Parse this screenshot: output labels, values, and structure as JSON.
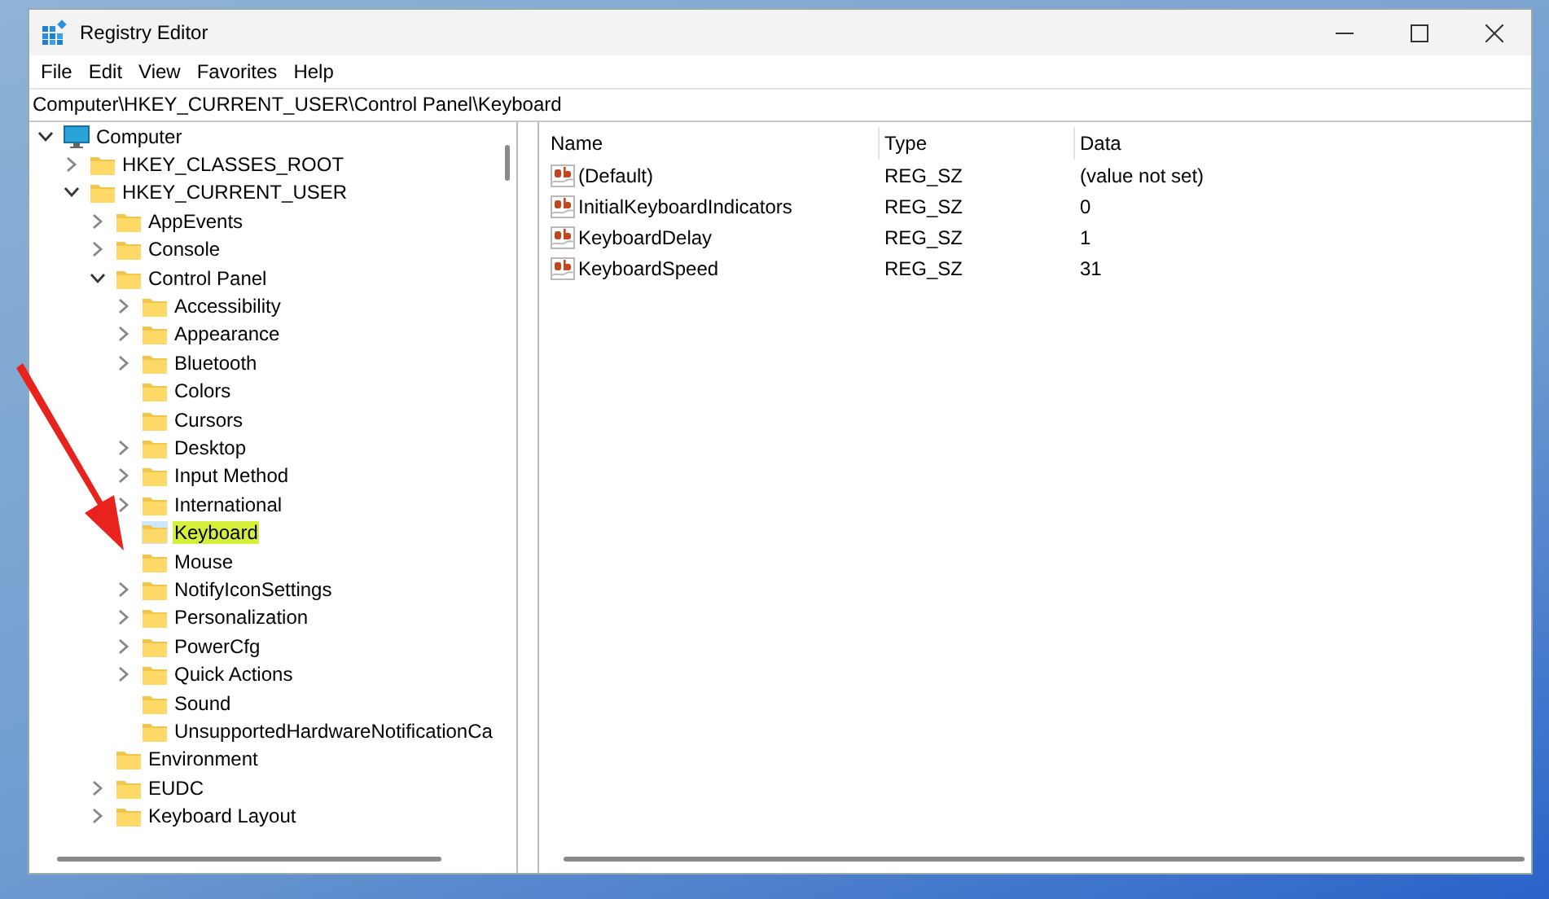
{
  "window": {
    "title": "Registry Editor"
  },
  "menu": [
    "File",
    "Edit",
    "View",
    "Favorites",
    "Help"
  ],
  "address": "Computer\\HKEY_CURRENT_USER\\Control Panel\\Keyboard",
  "tree": [
    {
      "label": "Computer",
      "kind": "computer",
      "expandable": true,
      "expanded": true,
      "selected": false,
      "children": [
        {
          "label": "HKEY_CLASSES_ROOT",
          "kind": "folder",
          "expandable": true,
          "expanded": false,
          "selected": false
        },
        {
          "label": "HKEY_CURRENT_USER",
          "kind": "folder",
          "expandable": true,
          "expanded": true,
          "selected": false,
          "children": [
            {
              "label": "AppEvents",
              "kind": "folder",
              "expandable": true,
              "expanded": false,
              "selected": false
            },
            {
              "label": "Console",
              "kind": "folder",
              "expandable": true,
              "expanded": false,
              "selected": false
            },
            {
              "label": "Control Panel",
              "kind": "folder",
              "expandable": true,
              "expanded": true,
              "selected": false,
              "children": [
                {
                  "label": "Accessibility",
                  "kind": "folder",
                  "expandable": true,
                  "expanded": false,
                  "selected": false
                },
                {
                  "label": "Appearance",
                  "kind": "folder",
                  "expandable": true,
                  "expanded": false,
                  "selected": false
                },
                {
                  "label": "Bluetooth",
                  "kind": "folder",
                  "expandable": true,
                  "expanded": false,
                  "selected": false
                },
                {
                  "label": "Colors",
                  "kind": "folder",
                  "expandable": false,
                  "selected": false
                },
                {
                  "label": "Cursors",
                  "kind": "folder",
                  "expandable": false,
                  "selected": false
                },
                {
                  "label": "Desktop",
                  "kind": "folder",
                  "expandable": true,
                  "expanded": false,
                  "selected": false
                },
                {
                  "label": "Input Method",
                  "kind": "folder",
                  "expandable": true,
                  "expanded": false,
                  "selected": false
                },
                {
                  "label": "International",
                  "kind": "folder",
                  "expandable": true,
                  "expanded": false,
                  "selected": false
                },
                {
                  "label": "Keyboard",
                  "kind": "folder",
                  "expandable": false,
                  "selected": true
                },
                {
                  "label": "Mouse",
                  "kind": "folder",
                  "expandable": false,
                  "selected": false
                },
                {
                  "label": "NotifyIconSettings",
                  "kind": "folder",
                  "expandable": true,
                  "expanded": false,
                  "selected": false
                },
                {
                  "label": "Personalization",
                  "kind": "folder",
                  "expandable": true,
                  "expanded": false,
                  "selected": false
                },
                {
                  "label": "PowerCfg",
                  "kind": "folder",
                  "expandable": true,
                  "expanded": false,
                  "selected": false
                },
                {
                  "label": "Quick Actions",
                  "kind": "folder",
                  "expandable": true,
                  "expanded": false,
                  "selected": false
                },
                {
                  "label": "Sound",
                  "kind": "folder",
                  "expandable": false,
                  "selected": false
                },
                {
                  "label": "UnsupportedHardwareNotificationCa",
                  "kind": "folder",
                  "expandable": false,
                  "selected": false
                }
              ]
            },
            {
              "label": "Environment",
              "kind": "folder",
              "expandable": false,
              "selected": false
            },
            {
              "label": "EUDC",
              "kind": "folder",
              "expandable": true,
              "expanded": false,
              "selected": false
            },
            {
              "label": "Keyboard Layout",
              "kind": "folder",
              "expandable": true,
              "expanded": false,
              "selected": false
            }
          ]
        }
      ]
    }
  ],
  "table": {
    "columns": [
      "Name",
      "Type",
      "Data"
    ],
    "rows": [
      {
        "name": "(Default)",
        "type": "REG_SZ",
        "data": "(value not set)"
      },
      {
        "name": "InitialKeyboardIndicators",
        "type": "REG_SZ",
        "data": "0"
      },
      {
        "name": "KeyboardDelay",
        "type": "REG_SZ",
        "data": "1"
      },
      {
        "name": "KeyboardSpeed",
        "type": "REG_SZ",
        "data": "31"
      }
    ]
  }
}
